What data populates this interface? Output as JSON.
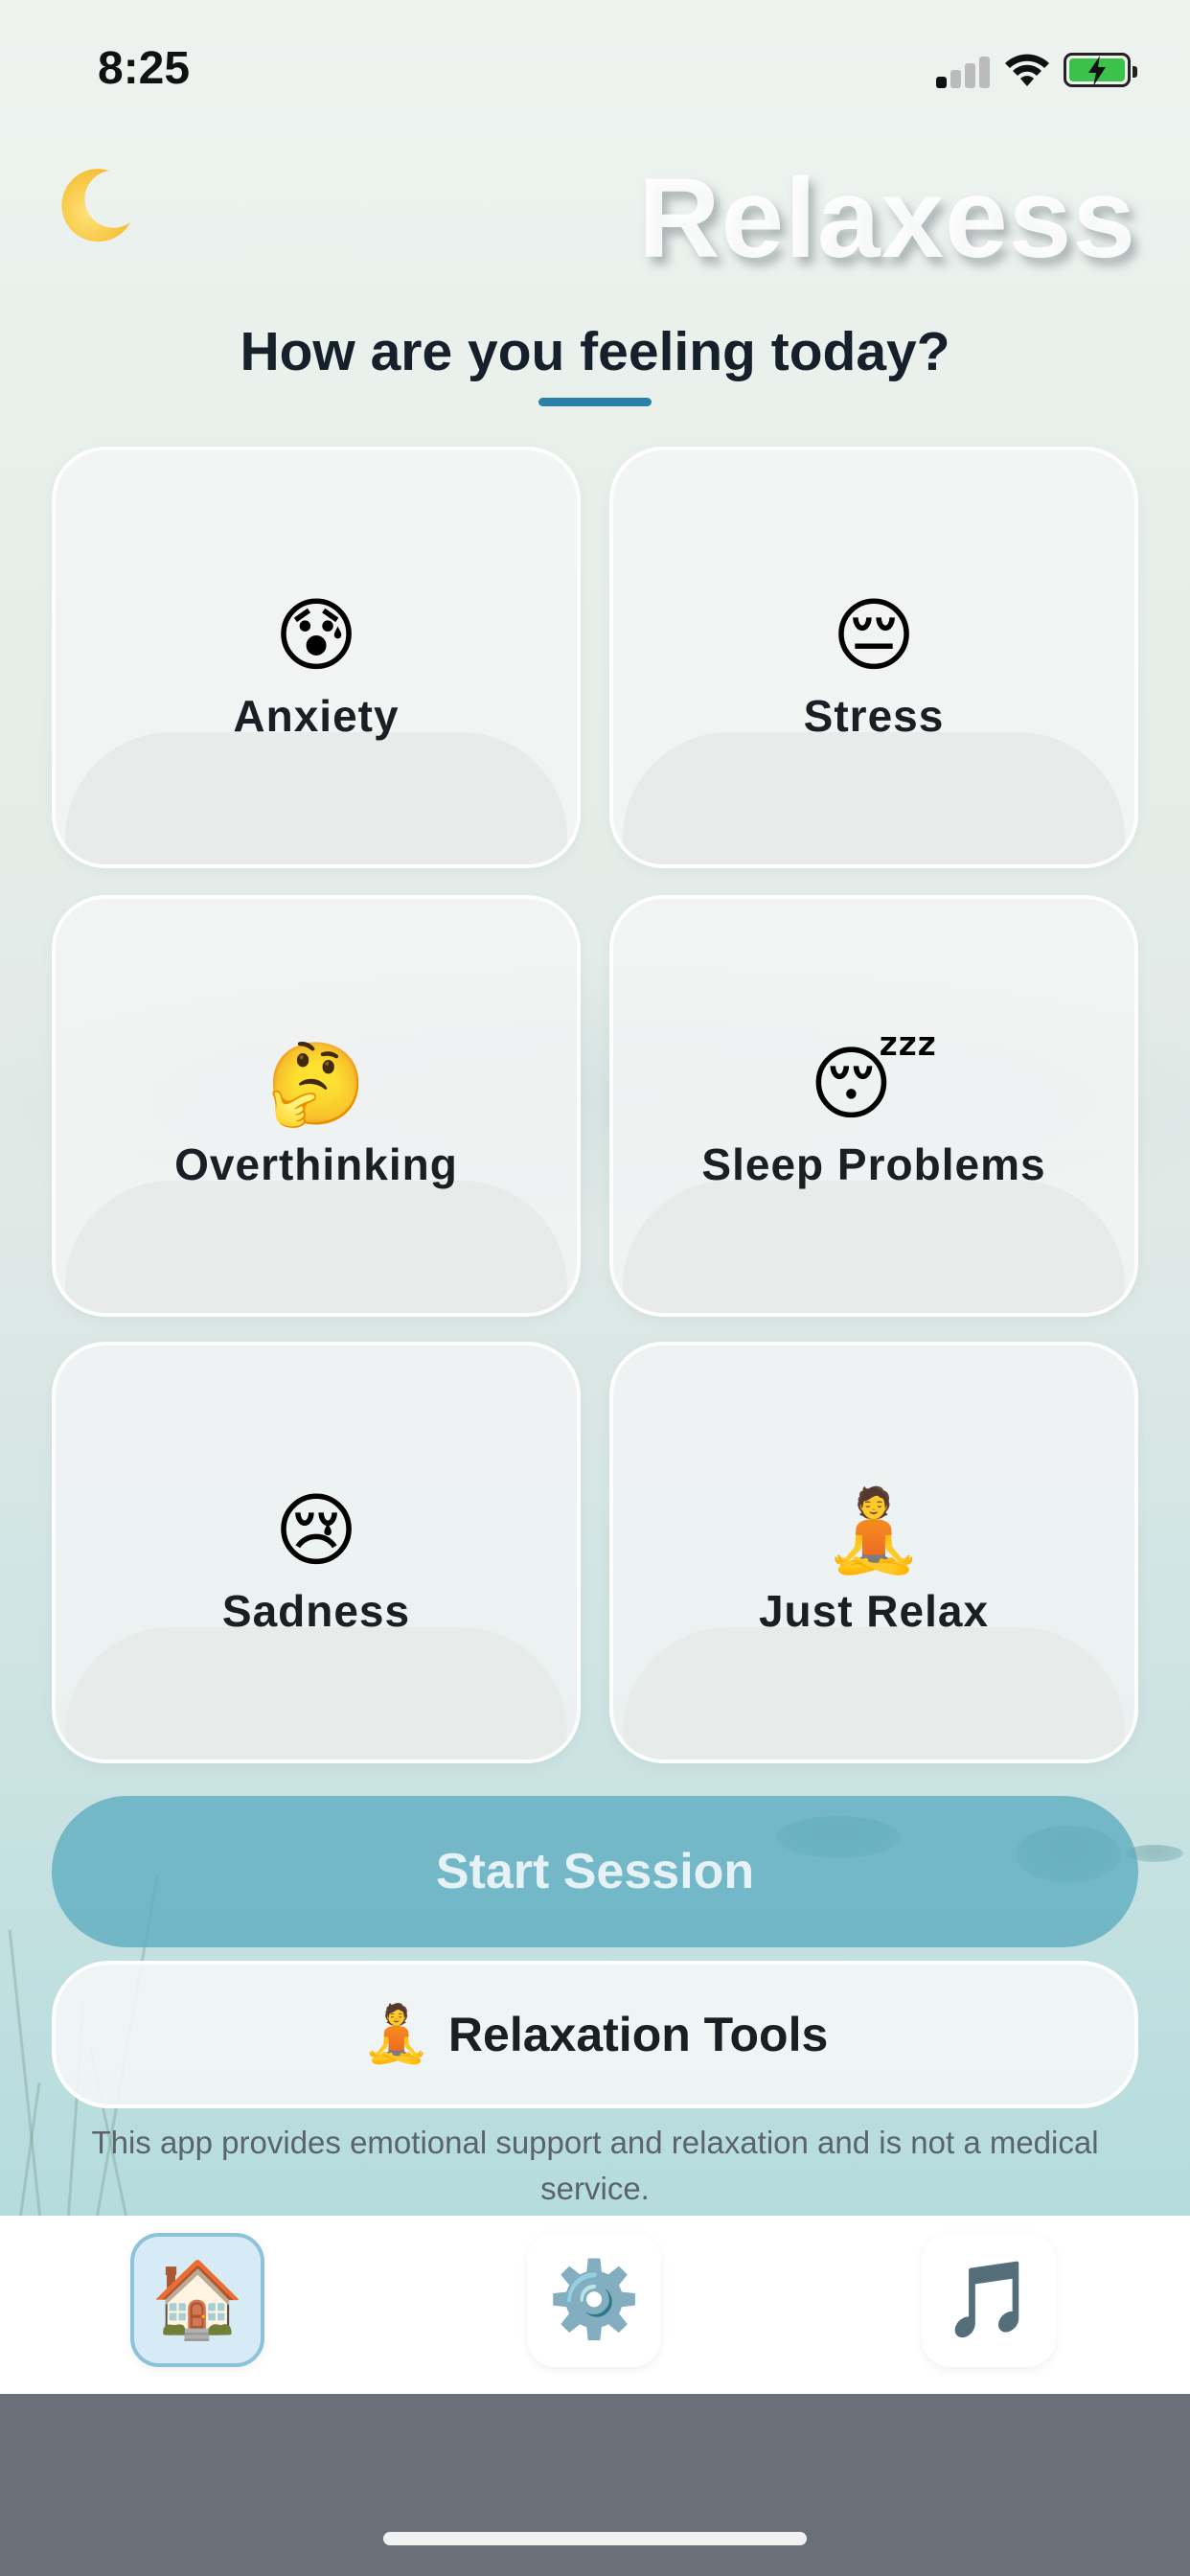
{
  "status_bar": {
    "time": "8:25"
  },
  "header": {
    "app_title": "Relaxess",
    "theme_icon": "crescent-moon-icon",
    "question": "How are you feeling today?"
  },
  "moods": [
    {
      "emoji": "😰",
      "label": "Anxiety"
    },
    {
      "emoji": "😔",
      "label": "Stress"
    },
    {
      "emoji": "🤔",
      "label": "Overthinking"
    },
    {
      "emoji": "😴",
      "label": "Sleep Problems"
    },
    {
      "emoji": "😢",
      "label": "Sadness"
    },
    {
      "emoji": "🧘",
      "label": "Just Relax"
    }
  ],
  "actions": {
    "start_session": "Start Session",
    "tools_emoji": "🧘",
    "relaxation_tools": "Relaxation Tools"
  },
  "disclaimer": "This app provides emotional support and relaxation and is not a medical service.",
  "tabs": [
    {
      "icon": "🏠",
      "name": "home-icon",
      "active": true
    },
    {
      "icon": "⚙️",
      "name": "gear-icon",
      "active": false
    },
    {
      "icon": "🎵",
      "name": "music-note-icon",
      "active": false
    }
  ],
  "colors": {
    "accent": "#2a80a6",
    "start_button": "#5cacc0",
    "active_tab": "#d6ebf5"
  }
}
